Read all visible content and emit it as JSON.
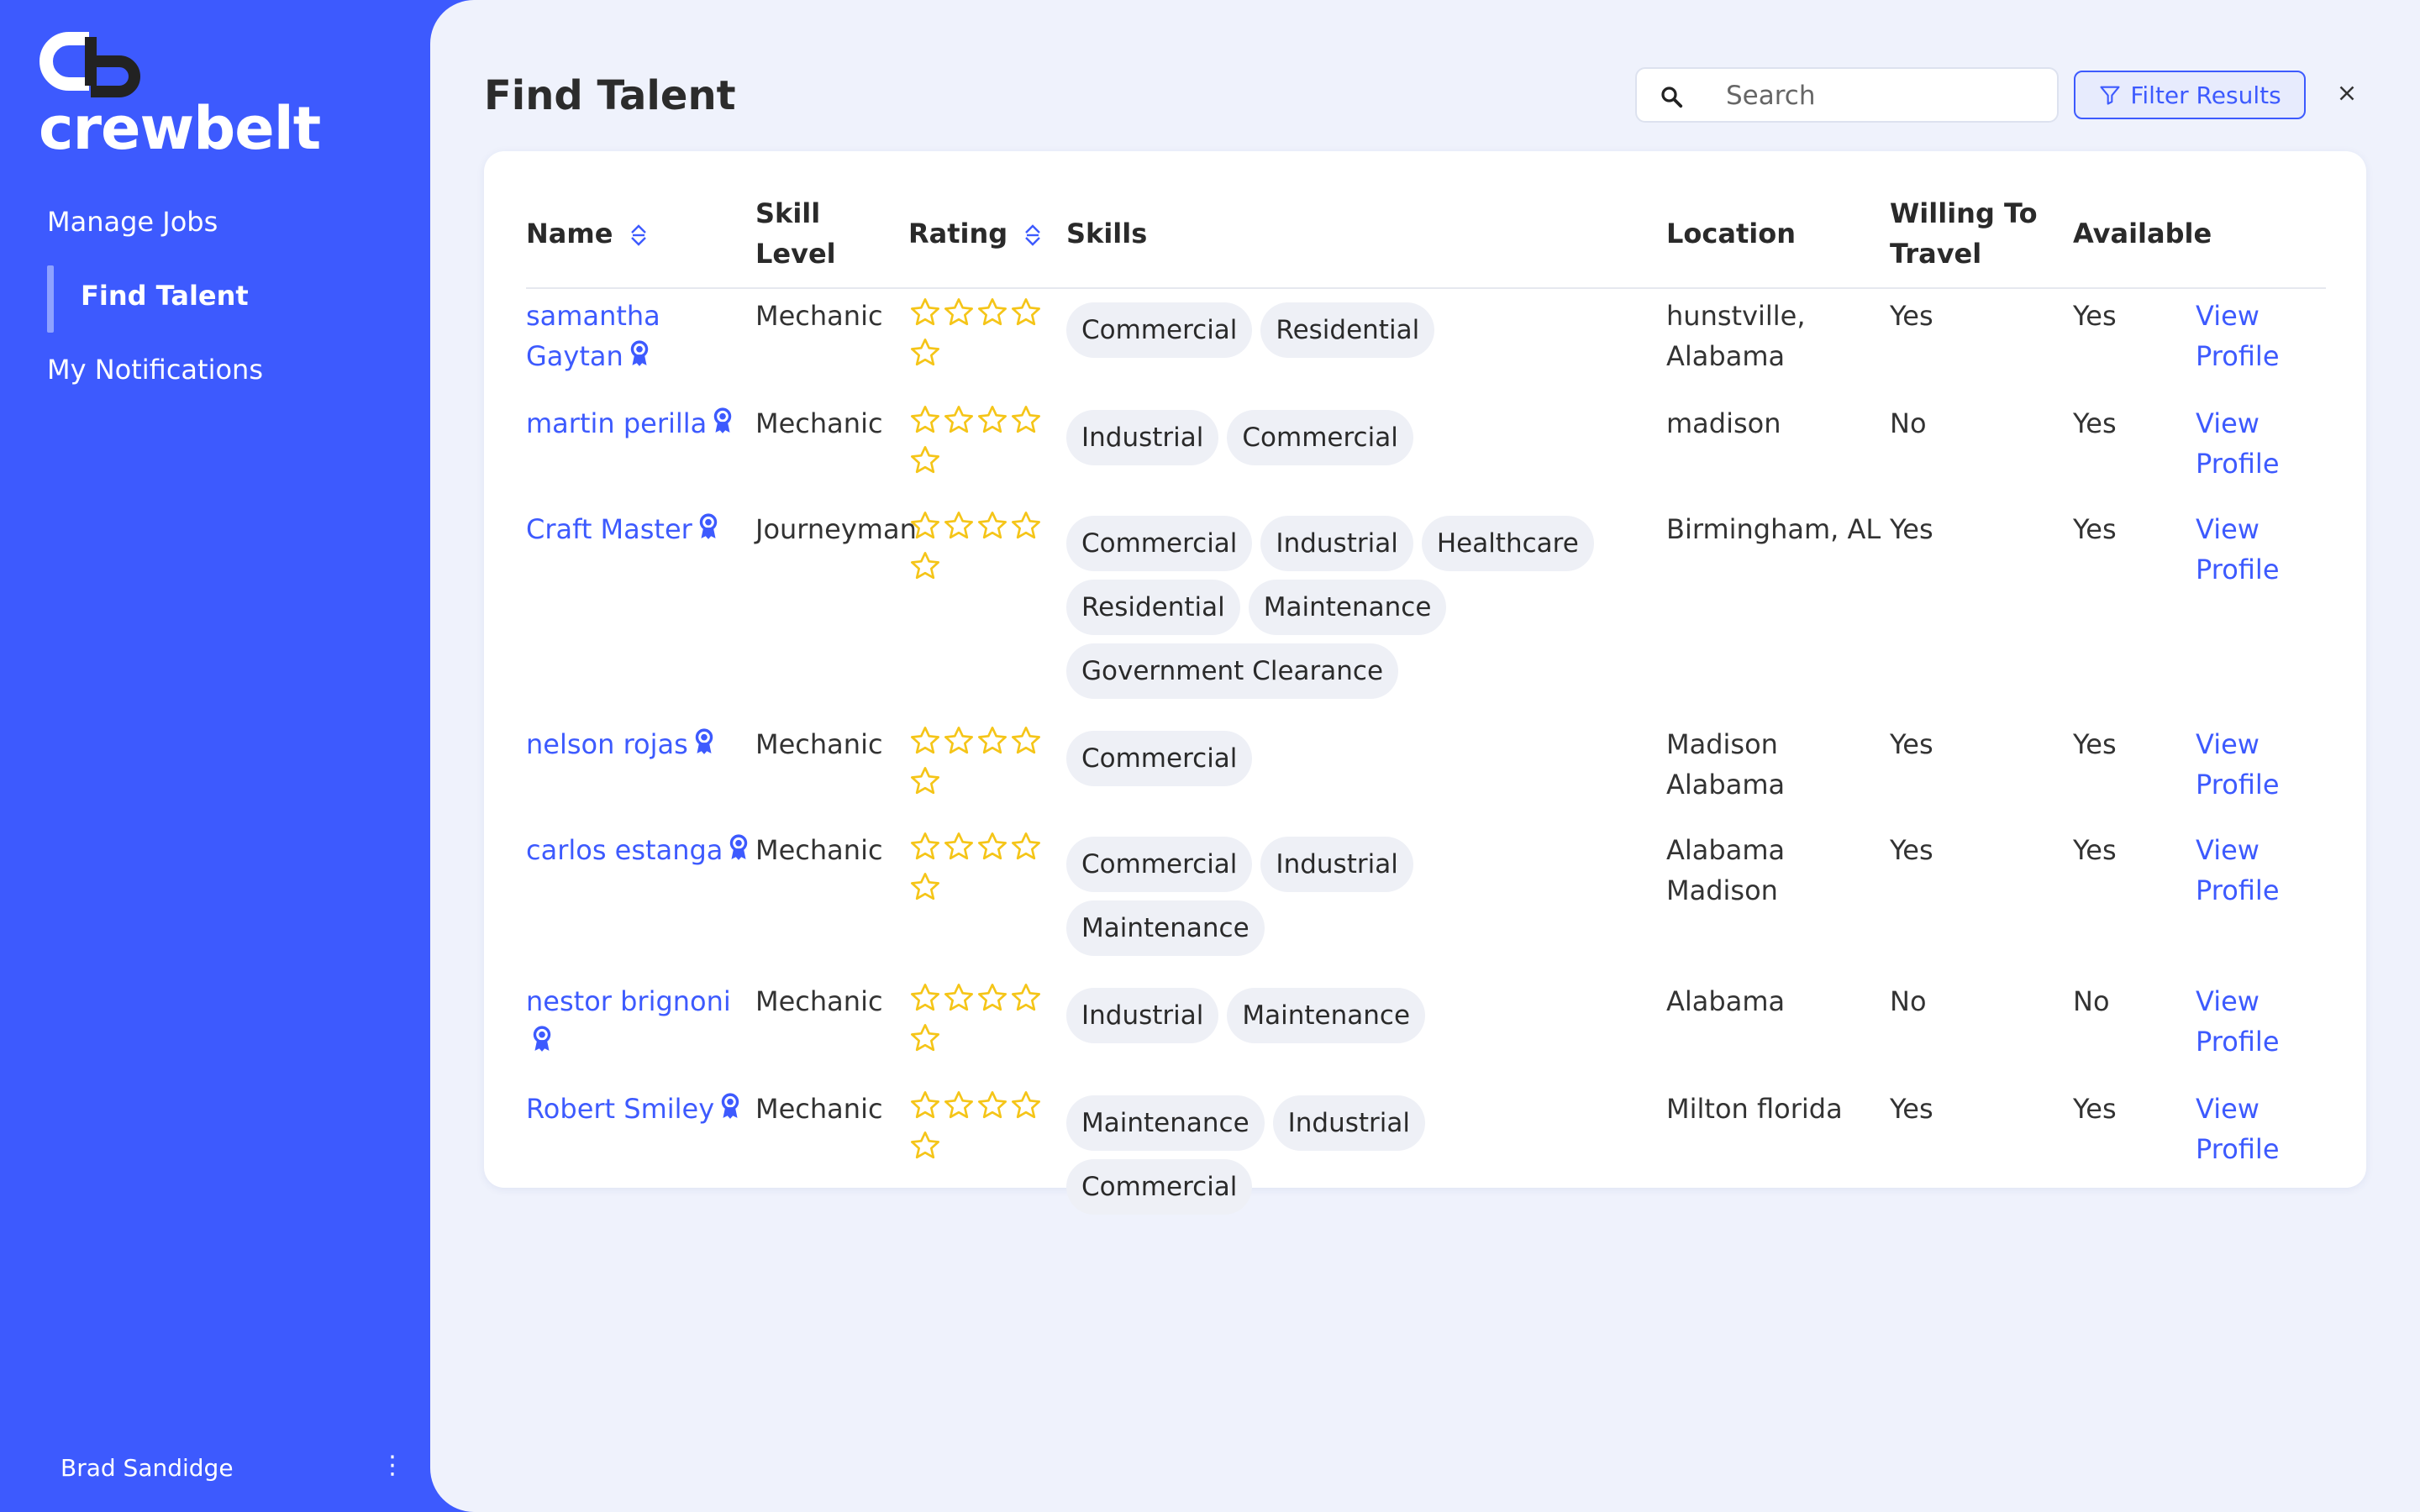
{
  "brand": {
    "name": "crewbelt",
    "accent": "#3d5afe"
  },
  "sidebar": {
    "items": [
      {
        "label": "Manage Jobs",
        "active": false
      },
      {
        "label": "Find Talent",
        "active": true
      },
      {
        "label": "My Notifications",
        "active": false
      }
    ],
    "user": {
      "name": "Brad Sandidge",
      "menu_icon": "⋮"
    }
  },
  "header": {
    "title": "Find Talent",
    "search": {
      "placeholder": "Search",
      "value": ""
    },
    "filter_label": "Filter Results"
  },
  "table": {
    "columns": {
      "name": "Name",
      "skill_level": "Skill Level",
      "rating": "Rating",
      "skills": "Skills",
      "location": "Location",
      "willing_to_travel": "Willing To Travel",
      "available": "Available"
    },
    "view_label_1": "View",
    "view_label_2": "Profile",
    "rows": [
      {
        "name": "samantha Gaytan",
        "skill_level": "Mechanic",
        "rating": 0,
        "skills": [
          "Commercial",
          "Residential"
        ],
        "location": "hunstville, Alabama",
        "willing_to_travel": "Yes",
        "available": "Yes"
      },
      {
        "name": "martin perilla",
        "skill_level": "Mechanic",
        "rating": 0,
        "skills": [
          "Industrial",
          "Commercial"
        ],
        "location": "madison",
        "willing_to_travel": "No",
        "available": "Yes"
      },
      {
        "name": "Craft Master",
        "skill_level": "Journeyman",
        "rating": 0,
        "skills": [
          "Commercial",
          "Industrial",
          "Healthcare",
          "Residential",
          "Maintenance",
          "Government Clearance"
        ],
        "location": "Birmingham, AL",
        "willing_to_travel": "Yes",
        "available": "Yes"
      },
      {
        "name": "nelson rojas",
        "skill_level": "Mechanic",
        "rating": 0,
        "skills": [
          "Commercial"
        ],
        "location": "Madison Alabama",
        "willing_to_travel": "Yes",
        "available": "Yes"
      },
      {
        "name": "carlos estanga",
        "skill_level": "Mechanic",
        "rating": 0,
        "skills": [
          "Commercial",
          "Industrial",
          "Maintenance"
        ],
        "location": "Alabama Madison",
        "willing_to_travel": "Yes",
        "available": "Yes"
      },
      {
        "name": "nestor brignoni",
        "skill_level": "Mechanic",
        "rating": 0,
        "skills": [
          "Industrial",
          "Maintenance"
        ],
        "location": "Alabama",
        "willing_to_travel": "No",
        "available": "No"
      },
      {
        "name": "Robert Smiley",
        "skill_level": "Mechanic",
        "rating": 0,
        "skills": [
          "Maintenance",
          "Industrial",
          "Commercial"
        ],
        "location": "Milton florida",
        "willing_to_travel": "Yes",
        "available": "Yes"
      }
    ]
  },
  "colors": {
    "sidebar": "#3d5afe",
    "star": "#f5c518",
    "chip_bg": "#eef0f6",
    "main_bg": "#eff2fc"
  },
  "icons": {
    "search": "search-icon",
    "filter": "filter-icon",
    "close": "close-icon",
    "sort": "sort-icon",
    "badge": "award-ribbon-icon",
    "star": "star-outline-icon"
  }
}
